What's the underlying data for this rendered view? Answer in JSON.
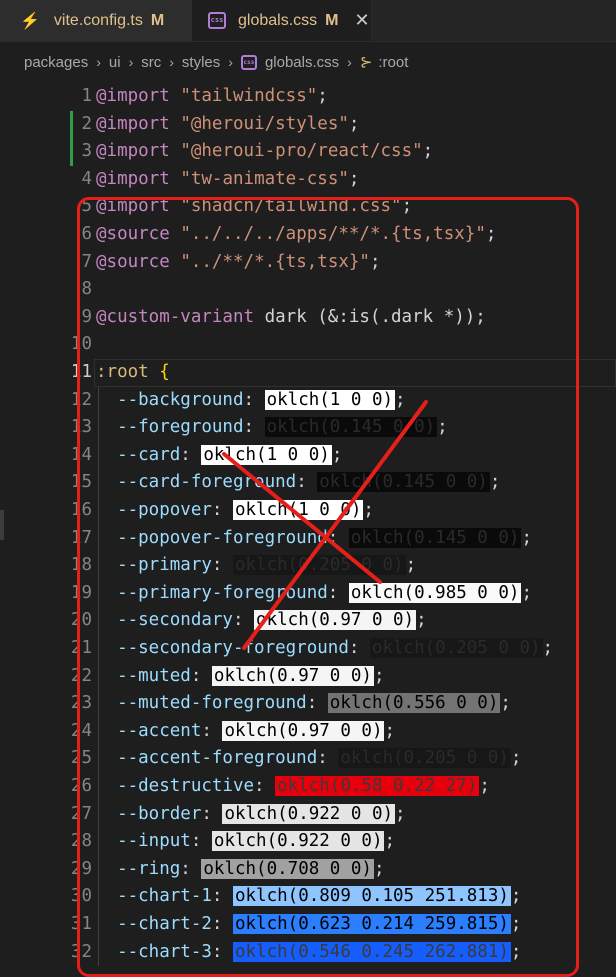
{
  "tabs": [
    {
      "label": "vite.config.ts",
      "status": "M",
      "icon": "bolt-icon",
      "active": false
    },
    {
      "label": "globals.css",
      "status": "M",
      "icon": "css-file-icon",
      "active": true
    }
  ],
  "breadcrumb": [
    "packages",
    "ui",
    "src",
    "styles",
    "globals.css",
    ":root"
  ],
  "lines": [
    {
      "n": "1",
      "tokens": [
        [
          "kw",
          "@import"
        ],
        [
          "pun",
          " "
        ],
        [
          "str",
          "\"tailwindcss\""
        ],
        [
          "pun",
          ";"
        ]
      ]
    },
    {
      "n": "2",
      "tokens": [
        [
          "kw",
          "@import"
        ],
        [
          "pun",
          " "
        ],
        [
          "str",
          "\"@heroui/styles\""
        ],
        [
          "pun",
          ";"
        ]
      ],
      "mod": true
    },
    {
      "n": "3",
      "tokens": [
        [
          "kw",
          "@import"
        ],
        [
          "pun",
          " "
        ],
        [
          "str",
          "\"@heroui-pro/react/css\""
        ],
        [
          "pun",
          ";"
        ]
      ],
      "mod": true
    },
    {
      "n": "4",
      "tokens": [
        [
          "kw",
          "@import"
        ],
        [
          "pun",
          " "
        ],
        [
          "str",
          "\"tw-animate-css\""
        ],
        [
          "pun",
          ";"
        ]
      ]
    },
    {
      "n": "5",
      "tokens": [
        [
          "kw",
          "@import"
        ],
        [
          "pun",
          " "
        ],
        [
          "str",
          "\"shadcn/tailwind.css\""
        ],
        [
          "pun",
          ";"
        ]
      ]
    },
    {
      "n": "6",
      "tokens": [
        [
          "kw",
          "@source"
        ],
        [
          "pun",
          " "
        ],
        [
          "str",
          "\"../../../apps/**/*.{ts,tsx}\""
        ],
        [
          "pun",
          ";"
        ]
      ]
    },
    {
      "n": "7",
      "tokens": [
        [
          "kw",
          "@source"
        ],
        [
          "pun",
          " "
        ],
        [
          "str",
          "\"../**/*.{ts,tsx}\""
        ],
        [
          "pun",
          ";"
        ]
      ]
    },
    {
      "n": "8",
      "tokens": []
    },
    {
      "n": "9",
      "tokens": [
        [
          "kw",
          "@custom-variant"
        ],
        [
          "pun",
          " dark (&:is(.dark *));"
        ]
      ]
    },
    {
      "n": "10",
      "tokens": []
    },
    {
      "n": "11",
      "tokens": [
        [
          "sel",
          ":root"
        ],
        [
          "pun",
          " "
        ],
        [
          "brk",
          "{"
        ]
      ],
      "current": true
    },
    {
      "n": "12",
      "tokens": [
        [
          "prop",
          "  --background"
        ],
        [
          "pun",
          ": "
        ],
        [
          "sw",
          "oklch(1 0 0)",
          "#ffffff"
        ],
        [
          "pun",
          ";"
        ]
      ]
    },
    {
      "n": "13",
      "tokens": [
        [
          "prop",
          "  --foreground"
        ],
        [
          "pun",
          ": "
        ],
        [
          "sw",
          "oklch(0.145 0 0)",
          "#0a0a0a"
        ],
        [
          "pun",
          ";"
        ]
      ]
    },
    {
      "n": "14",
      "tokens": [
        [
          "prop",
          "  --card"
        ],
        [
          "pun",
          ": "
        ],
        [
          "sw",
          "oklch(1 0 0)",
          "#ffffff"
        ],
        [
          "pun",
          ";"
        ]
      ]
    },
    {
      "n": "15",
      "tokens": [
        [
          "prop",
          "  --card-foreground"
        ],
        [
          "pun",
          ": "
        ],
        [
          "sw",
          "oklch(0.145 0 0)",
          "#0a0a0a"
        ],
        [
          "pun",
          ";"
        ]
      ]
    },
    {
      "n": "16",
      "tokens": [
        [
          "prop",
          "  --popover"
        ],
        [
          "pun",
          ": "
        ],
        [
          "sw",
          "oklch(1 0 0)",
          "#ffffff"
        ],
        [
          "pun",
          ";"
        ]
      ]
    },
    {
      "n": "17",
      "tokens": [
        [
          "prop",
          "  --popover-foreground"
        ],
        [
          "pun",
          ": "
        ],
        [
          "sw",
          "oklch(0.145 0 0)",
          "#0a0a0a"
        ],
        [
          "pun",
          ";"
        ]
      ]
    },
    {
      "n": "18",
      "tokens": [
        [
          "prop",
          "  --primary"
        ],
        [
          "pun",
          ": "
        ],
        [
          "sw",
          "oklch(0.205 0 0)",
          "#171717"
        ],
        [
          "pun",
          ";"
        ]
      ]
    },
    {
      "n": "19",
      "tokens": [
        [
          "prop",
          "  --primary-foreground"
        ],
        [
          "pun",
          ": "
        ],
        [
          "sw",
          "oklch(0.985 0 0)",
          "#fafafa"
        ],
        [
          "pun",
          ";"
        ]
      ]
    },
    {
      "n": "20",
      "tokens": [
        [
          "prop",
          "  --secondary"
        ],
        [
          "pun",
          ": "
        ],
        [
          "sw",
          "oklch(0.97 0 0)",
          "#f5f5f5"
        ],
        [
          "pun",
          ";"
        ]
      ]
    },
    {
      "n": "21",
      "tokens": [
        [
          "prop",
          "  --secondary-foreground"
        ],
        [
          "pun",
          ": "
        ],
        [
          "sw",
          "oklch(0.205 0 0)",
          "#171717"
        ],
        [
          "pun",
          ";"
        ]
      ]
    },
    {
      "n": "22",
      "tokens": [
        [
          "prop",
          "  --muted"
        ],
        [
          "pun",
          ": "
        ],
        [
          "sw",
          "oklch(0.97 0 0)",
          "#f5f5f5"
        ],
        [
          "pun",
          ";"
        ]
      ]
    },
    {
      "n": "23",
      "tokens": [
        [
          "prop",
          "  --muted-foreground"
        ],
        [
          "pun",
          ": "
        ],
        [
          "sw",
          "oklch(0.556 0 0)",
          "#737373"
        ],
        [
          "pun",
          ";"
        ]
      ]
    },
    {
      "n": "24",
      "tokens": [
        [
          "prop",
          "  --accent"
        ],
        [
          "pun",
          ": "
        ],
        [
          "sw",
          "oklch(0.97 0 0)",
          "#f5f5f5"
        ],
        [
          "pun",
          ";"
        ]
      ]
    },
    {
      "n": "25",
      "tokens": [
        [
          "prop",
          "  --accent-foreground"
        ],
        [
          "pun",
          ": "
        ],
        [
          "sw",
          "oklch(0.205 0 0)",
          "#171717"
        ],
        [
          "pun",
          ";"
        ]
      ]
    },
    {
      "n": "26",
      "tokens": [
        [
          "prop",
          "  --destructive"
        ],
        [
          "pun",
          ": "
        ],
        [
          "sw",
          "oklch(0.58 0.22 27)",
          "#e7000b"
        ],
        [
          "pun",
          ";"
        ]
      ]
    },
    {
      "n": "27",
      "tokens": [
        [
          "prop",
          "  --border"
        ],
        [
          "pun",
          ": "
        ],
        [
          "sw",
          "oklch(0.922 0 0)",
          "#e5e5e5"
        ],
        [
          "pun",
          ";"
        ]
      ]
    },
    {
      "n": "28",
      "tokens": [
        [
          "prop",
          "  --input"
        ],
        [
          "pun",
          ": "
        ],
        [
          "sw",
          "oklch(0.922 0 0)",
          "#e5e5e5"
        ],
        [
          "pun",
          ";"
        ]
      ]
    },
    {
      "n": "29",
      "tokens": [
        [
          "prop",
          "  --ring"
        ],
        [
          "pun",
          ": "
        ],
        [
          "sw",
          "oklch(0.708 0 0)",
          "#a1a1a1"
        ],
        [
          "pun",
          ";"
        ]
      ]
    },
    {
      "n": "30",
      "tokens": [
        [
          "prop",
          "  --chart-1"
        ],
        [
          "pun",
          ": "
        ],
        [
          "sw",
          "oklch(0.809 0.105 251.813)",
          "#8ec5ff"
        ],
        [
          "pun",
          ";"
        ]
      ]
    },
    {
      "n": "31",
      "tokens": [
        [
          "prop",
          "  --chart-2"
        ],
        [
          "pun",
          ": "
        ],
        [
          "sw",
          "oklch(0.623 0.214 259.815)",
          "#2b7fff"
        ],
        [
          "pun",
          ";"
        ]
      ]
    },
    {
      "n": "32",
      "tokens": [
        [
          "prop",
          "  --chart-3"
        ],
        [
          "pun",
          ": "
        ],
        [
          "sw",
          "oklch(0.546 0.245 262.881)",
          "#155dfc"
        ],
        [
          "pun",
          ";"
        ]
      ]
    }
  ],
  "colors": {
    "annotation": "#e5201b",
    "gutter_modified": "#2ea043"
  }
}
